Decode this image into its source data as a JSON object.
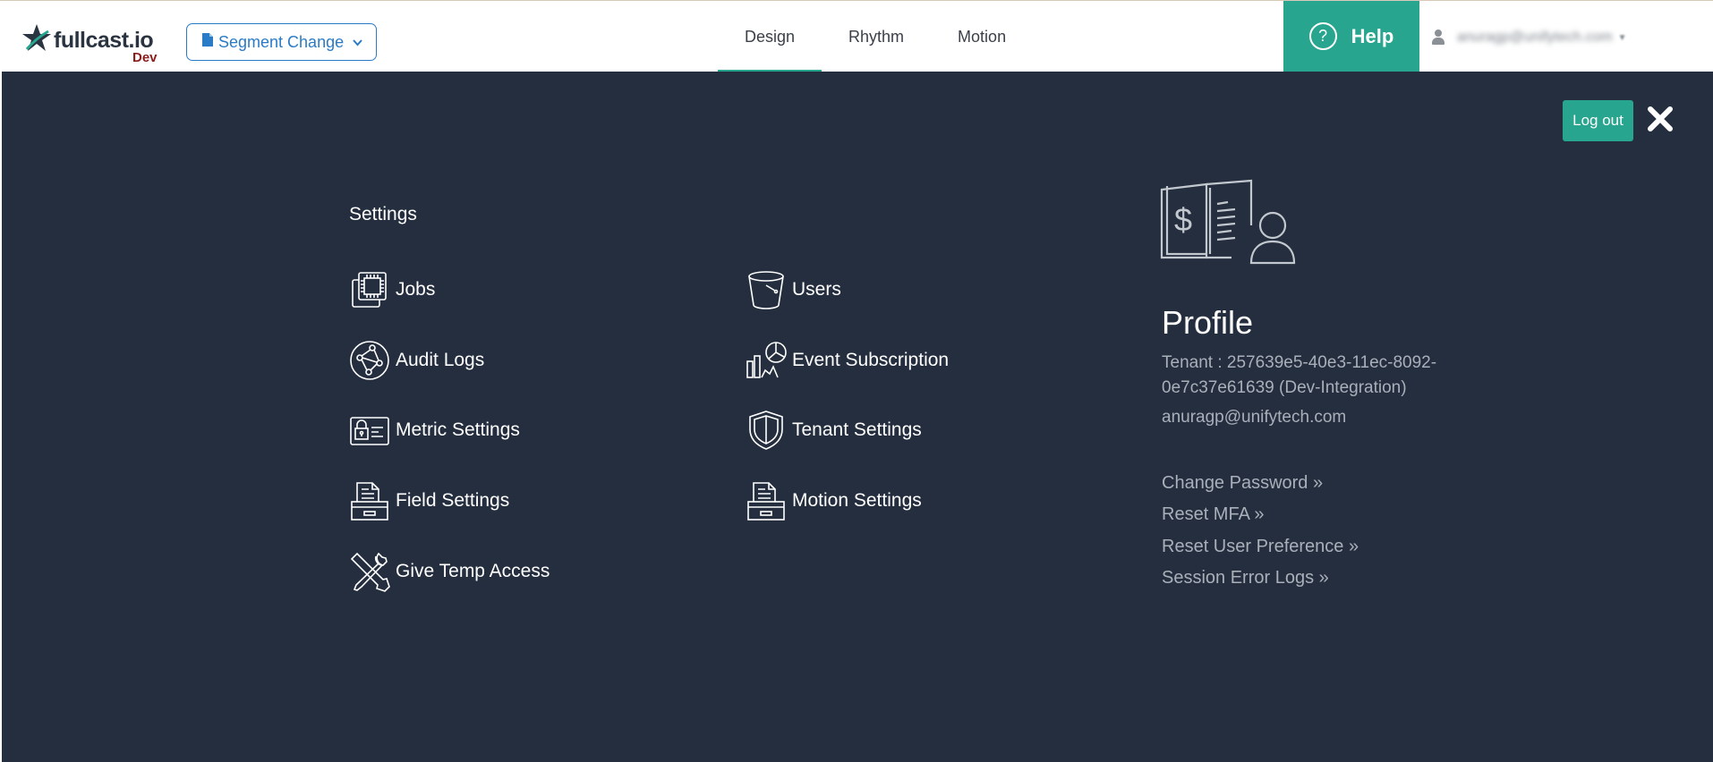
{
  "header": {
    "logo_text": "fullcast.io",
    "env_label": "Dev",
    "segment_button": "Segment Change",
    "tabs": [
      {
        "label": "Design",
        "active": true
      },
      {
        "label": "Rhythm",
        "active": false
      },
      {
        "label": "Motion",
        "active": false
      }
    ],
    "help_label": "Help",
    "help_icon": "?",
    "user_email": "anuragp@unifytech.com"
  },
  "overlay": {
    "logout_label": "Log out",
    "settings_title": "Settings",
    "items": [
      {
        "label": "Jobs",
        "icon": "cpu-chip-icon"
      },
      {
        "label": "Users",
        "icon": "bucket-icon"
      },
      {
        "label": "Audit Logs",
        "icon": "network-circle-icon"
      },
      {
        "label": "Event Subscription",
        "icon": "analytics-icon"
      },
      {
        "label": "Metric Settings",
        "icon": "id-card-lock-icon"
      },
      {
        "label": "Tenant Settings",
        "icon": "shield-icon"
      },
      {
        "label": "Field Settings",
        "icon": "file-drawer-icon"
      },
      {
        "label": "Motion Settings",
        "icon": "file-drawer-icon"
      },
      {
        "label": "Give Temp Access",
        "icon": "tools-icon"
      }
    ],
    "profile": {
      "title": "Profile",
      "tenant": "Tenant : 257639e5-40e3-11ec-8092-0e7c37e61639 (Dev-Integration)",
      "email": "anuragp@unifytech.com",
      "links": [
        "Change Password »",
        "Reset MFA »",
        "Reset User Preference »",
        "Session Error Logs »"
      ]
    }
  },
  "colors": {
    "accent": "#27a58f",
    "overlay_bg": "#242e3e",
    "link_blue": "#2a7bc7",
    "env_red": "#8a1c1c"
  }
}
